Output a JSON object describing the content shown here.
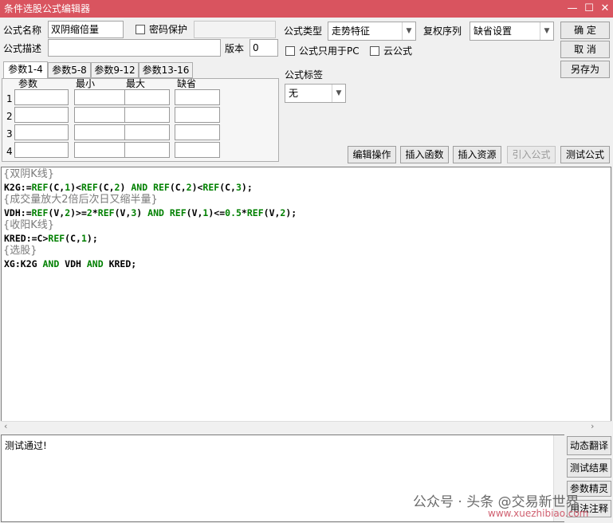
{
  "window": {
    "title": "条件选股公式编辑器",
    "minimize": "—",
    "maximize": "☐",
    "close": "✕"
  },
  "form": {
    "name_label": "公式名称",
    "name_value": "双阴缩倍量",
    "password_label": "密码保护",
    "password_checked": false,
    "desc_label": "公式描述",
    "desc_value": "",
    "version_label": "版本",
    "version_value": "0",
    "type_label": "公式类型",
    "type_value": "走势特征",
    "rights_label": "复权序列",
    "rights_value": "缺省设置",
    "pc_only_label": "公式只用于PC",
    "cloud_label": "云公式",
    "tag_label": "公式标签",
    "tag_value": "无"
  },
  "buttons": {
    "ok": "确 定",
    "cancel": "取 消",
    "save_as": "另存为",
    "edit_op": "编辑操作",
    "insert_func": "插入函数",
    "insert_res": "插入资源",
    "import_formula": "引入公式",
    "test_formula": "测试公式"
  },
  "params": {
    "tabs": [
      "参数1-4",
      "参数5-8",
      "参数9-12",
      "参数13-16"
    ],
    "active_tab": 0,
    "headers": [
      "参数",
      "最小",
      "最大",
      "缺省"
    ],
    "rows": [
      "1",
      "2",
      "3",
      "4"
    ]
  },
  "code": {
    "comment1": "{双阴K线}",
    "line1": "K2G:=REF(C,1)<REF(C,2) AND REF(C,2)<REF(C,3);",
    "comment2": "{成交量放大2倍后次日又缩半量}",
    "line2": "VDH:=REF(V,2)>=2*REF(V,3) AND REF(V,1)<=0.5*REF(V,2);",
    "comment3": "{收阳K线}",
    "line3": "KRED:=C>REF(C,1);",
    "comment4": "{选股}",
    "line4": "XG:K2G AND VDH AND KRED;"
  },
  "result": {
    "text": "测试通过!"
  },
  "side_buttons": [
    "动态翻译",
    "测试结果",
    "参数精灵",
    "用法注释"
  ],
  "watermark": {
    "text1": "公众号 · 头条 @交易新世界",
    "text2": "www.xuezhibiao.com"
  }
}
